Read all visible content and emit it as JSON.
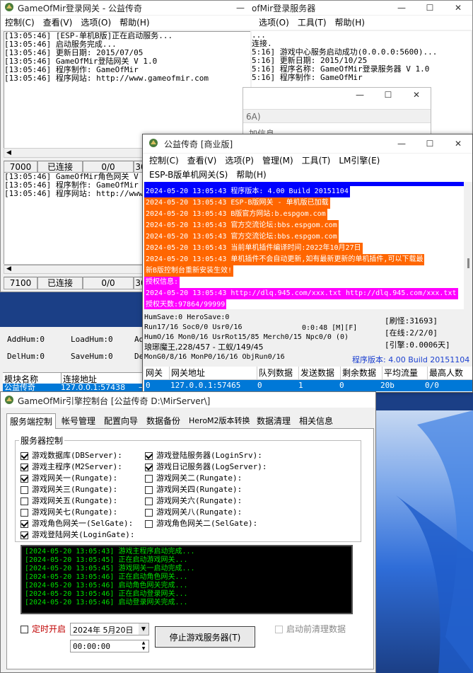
{
  "desktop": {
    "colors": {
      "base": "#1b3f86",
      "wallpaper_top": "#c6d8f2",
      "wallpaper_mid": "#2f6dd8"
    }
  },
  "login_gate": {
    "title": "GameOfMir登录网关 - 公益传奇",
    "menu": [
      "控制(C)",
      "查看(V)",
      "选项(O)",
      "帮助(H)"
    ],
    "log": [
      "[13:05:46] [ESP-单机B版]正在启动服务...",
      "[13:05:46] 启动服务完成...",
      "[13:05:46] 更新日期: 2015/07/05",
      "[13:05:46] GameOfMir登陆网关 V 1.0",
      "[13:05:46] 程序制作: GameOfMir",
      "[13:05:46] 程序网站: http://www.gameofmir.com"
    ],
    "status": [
      "7000",
      "已连接",
      "0/0",
      "30"
    ]
  },
  "login_server": {
    "title": "ofMir登录服务器",
    "menu": [
      "选项(O)",
      "工具(T)",
      "帮助(H)"
    ],
    "log": [
      "...",
      "连接.",
      "",
      "5:16] 游戏中心服务启动成功(0.0.0.0:5600)...",
      "5:16] 更新日期: 2015/10/25",
      "5:16] 程序名称: GameOfMir登录服务器 V 1.0",
      "5:16] 程序制作: GameOfMir"
    ]
  },
  "ghost_window": {
    "fragment": "6A)",
    "fragment2": "加信息"
  },
  "role_gate": {
    "log": [
      "[13:05:46] GameOfMir角色网关 V 1.",
      "[13:05:46] 程序制作: GameOfMir",
      "[13:05:46] 程序网站: http://www.g"
    ],
    "status": [
      "7100",
      "已连接",
      "0/0",
      "30"
    ]
  },
  "db_panel": {
    "labels": [
      "AddHum:0",
      "LoadHum:0",
      "Ad",
      "DelHum:0",
      "SaveHum:0",
      "De"
    ],
    "table_headers": [
      "模块名称",
      "连接地址"
    ],
    "row": [
      "公益传奇",
      "127.0.0.1:57438",
      "→"
    ]
  },
  "m2": {
    "title": "公益传奇 [商业版]",
    "menu": [
      "控制(C)",
      "查看(V)",
      "选项(P)",
      "管理(M)",
      "工具(T)",
      "LM引擎(E)"
    ],
    "menu2": [
      "ESP-B版单机网关(S)",
      "帮助(H)"
    ],
    "log_top": "程序版本: 4.00 Build 20151104",
    "log": [
      {
        "text": "2024-05-20 13:05:43 程序版本: 4.00 Build 20151104",
        "bg": "#0000ff"
      },
      {
        "text": "2024-05-20 13:05:43 ESP-B版网关 - 单机版已加载",
        "bg": "#ff6600"
      },
      {
        "text": "2024-05-20 13:05:43 B版官方网站:b.espgom.com",
        "bg": "#ff6600"
      },
      {
        "text": "2024-05-20 13:05:43 官方交流论坛:bbs.espgom.com",
        "bg": "#ff6600"
      },
      {
        "text": "2024-05-20 13:05:43 官方交流论坛:bbs.espgom.com",
        "bg": "#ff6600"
      },
      {
        "text": "2024-05-20 13:05:43 当前单机插件编译时间:2022年10月27日",
        "bg": "#ff6600"
      },
      {
        "text": "2024-05-20 13:05:43 单机插件不会自动更新,如有最新更新的单机插件,可以下载最",
        "bg": "#ff6600"
      },
      {
        "text": "新B版控制台重新安装生效!",
        "bg": "#ff6600"
      },
      {
        "text": "授权信息:",
        "bg": "#ff00ff"
      },
      {
        "text": "2024-05-20 13:05:43 http://dlq.945.com/xxx.txt http://dlq.945.com/xxx.txt",
        "bg": "#ff00ff"
      },
      {
        "text": "授权天数:97864/99999",
        "bg": "#ff00ff"
      }
    ],
    "stats": [
      "HumSave:0 HeroSave:0",
      "Run17/16 Soc0/0 Usr0/16",
      "HumO/16 Mon0/16 UsrRot15/85 Merch0/15 Npc0/0 (0)",
      "琅琊魔王,228/457 - 工蚁/149/45",
      "MonG0/8/16 MonP0/16/16 ObjRun0/16"
    ],
    "clock": "0:0:48 [M][F]",
    "right": [
      "[刷怪:31693]",
      "[在线:2/2/0]",
      "[引擎:0.0006天]"
    ],
    "version": "程序版本: 4.00 Build 20151104",
    "table_headers": [
      "网关",
      "网关地址",
      "队列数据",
      "发送数据",
      "剩余数据",
      "平均流量",
      "最高人数"
    ],
    "table_row": [
      "0",
      "127.0.0.1:57465",
      "0",
      "1",
      "0",
      "20b",
      "0/0"
    ]
  },
  "ctrl": {
    "title": "GameOfMir引擎控制台 [公益传奇 D:\\MirServer\\]",
    "tabs": [
      "服务端控制",
      "帐号管理",
      "配置向导",
      "数据备份",
      "HeroM2版本转换",
      "数据清理",
      "相关信息"
    ],
    "group": "服务器控制",
    "left": [
      {
        "label": "游戏数据库(DBServer):",
        "checked": true
      },
      {
        "label": "游戏主程序(M2Server):",
        "checked": true
      },
      {
        "label": "游戏网关一(Rungate):",
        "checked": true
      },
      {
        "label": "游戏网关三(Rungate):",
        "checked": false
      },
      {
        "label": "游戏网关五(Rungate):",
        "checked": false
      },
      {
        "label": "游戏网关七(Rungate):",
        "checked": false
      },
      {
        "label": "游戏角色网关一(SelGate):",
        "checked": true
      },
      {
        "label": "游戏登陆网关(LoginGate):",
        "checked": true
      }
    ],
    "right": [
      {
        "label": "游戏登陆服务器(LoginSrv):",
        "checked": true
      },
      {
        "label": "游戏日记服务器(LogServer):",
        "checked": true
      },
      {
        "label": "游戏网关二(Rungate):",
        "checked": false
      },
      {
        "label": "游戏网关四(Rungate):",
        "checked": false
      },
      {
        "label": "游戏网关六(Rungate):",
        "checked": false
      },
      {
        "label": "游戏网关八(Rungate):",
        "checked": false
      },
      {
        "label": "游戏角色网关二(SelGate):",
        "checked": false
      }
    ],
    "console": [
      "[2024-05-20 13:05:43] 游戏主程序启动完成...",
      "[2024-05-20 13:05:45] 正在启动游戏网关...",
      "[2024-05-20 13:05:45] 游戏网关一启动完成...",
      "[2024-05-20 13:05:46] 正在启动角色网关...",
      "[2024-05-20 13:05:46] 启动角色网关完成...",
      "[2024-05-20 13:05:46] 正在启动登录网关...",
      "[2024-05-20 13:05:46] 启动登录网关完成..."
    ],
    "timer_label": "定时开启",
    "date": "2024年 5月20日",
    "time": "00:00:00",
    "stop_button": "停止游戏服务器(T)",
    "cleanup_label": "启动前清理数据"
  }
}
